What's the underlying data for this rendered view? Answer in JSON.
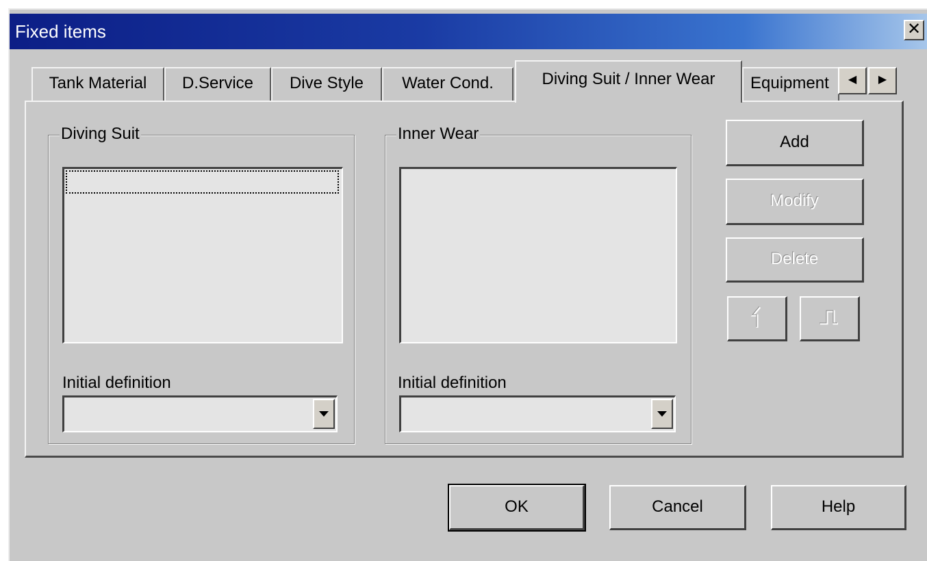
{
  "window": {
    "title": "Fixed items",
    "close_symbol": "✕"
  },
  "tabs": [
    {
      "label": "Tank Material",
      "active": false
    },
    {
      "label": "D.Service",
      "active": false
    },
    {
      "label": "Dive Style",
      "active": false
    },
    {
      "label": "Water Cond.",
      "active": false
    },
    {
      "label": "Diving Suit / Inner Wear",
      "active": true
    },
    {
      "label": "Equipment",
      "active": false
    }
  ],
  "tab_scroll": {
    "left_symbol": "◀",
    "right_symbol": "▶"
  },
  "diving_suit": {
    "group_label": "Diving Suit",
    "list_items": [],
    "initial_label": "Initial definition",
    "initial_value": ""
  },
  "inner_wear": {
    "group_label": "Inner Wear",
    "list_items": [],
    "initial_label": "Initial definition",
    "initial_value": ""
  },
  "side_buttons": {
    "add": "Add",
    "modify": "Modify",
    "delete": "Delete",
    "move_up_icon": "up-arrow-icon",
    "move_down_icon": "down-arrow-icon"
  },
  "footer": {
    "ok": "OK",
    "cancel": "Cancel",
    "help": "Help"
  }
}
